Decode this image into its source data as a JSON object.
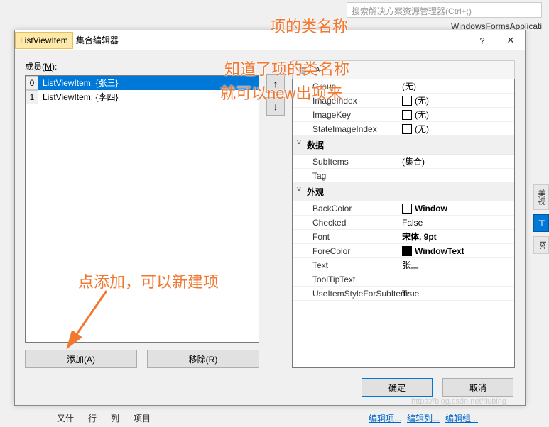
{
  "bg": {
    "search_placeholder": "搜索解决方案资源管理器(Ctrl+;)",
    "right_snippet": "WindowsFormsApplicati",
    "right_tabs": [
      "美视",
      "工",
      "ist"
    ],
    "bottom_items": [
      "又什",
      "行",
      "列",
      "项目"
    ],
    "bottom_links": [
      "编辑项...",
      "编辑列...",
      "编辑组..."
    ]
  },
  "dialog": {
    "title_highlight": "ListViewItem",
    "title_rest": " 集合编辑器",
    "help": "?",
    "close": "✕",
    "members_label_pre": "成员(",
    "members_label_u": "M",
    "members_label_post": "):",
    "members": [
      {
        "idx": "0",
        "text": "ListViewItem: {张三}",
        "selected": true
      },
      {
        "idx": "1",
        "text": "ListViewItem: {李四}",
        "selected": false
      }
    ],
    "add_btn": "添加(A)",
    "remove_btn": "移除(R)",
    "up": "↑",
    "down": "↓",
    "ok": "确定",
    "cancel": "取消"
  },
  "props": {
    "cats": [
      {
        "name": "行为_hidden",
        "rows": [
          {
            "name": "Group",
            "val": "(无)"
          },
          {
            "name": "ImageIndex",
            "val": "(无)",
            "swatch": "empty"
          },
          {
            "name": "ImageKey",
            "val": "(无)",
            "swatch": "empty"
          },
          {
            "name": "StateImageIndex",
            "val": "(无)",
            "swatch": "empty"
          }
        ]
      },
      {
        "name": "数据",
        "rows": [
          {
            "name": "SubItems",
            "val": "(集合)"
          },
          {
            "name": "Tag",
            "val": ""
          }
        ]
      },
      {
        "name": "外观",
        "rows": [
          {
            "name": "BackColor",
            "val": "Window",
            "swatch": "white",
            "bold": true
          },
          {
            "name": "Checked",
            "val": "False"
          },
          {
            "name": "Font",
            "val": "宋体, 9pt",
            "bold": true
          },
          {
            "name": "ForeColor",
            "val": "WindowText",
            "swatch": "black",
            "bold": true
          },
          {
            "name": "Text",
            "val": "张三"
          },
          {
            "name": "ToolTipText",
            "val": ""
          },
          {
            "name": "UseItemStyleForSubItems",
            "val": "True"
          }
        ]
      }
    ]
  },
  "annotations": {
    "a1": "项的类名称",
    "a2": "知道了项的类名称",
    "a3": "就可以new出项来",
    "a4": "点添加，可以新建项"
  },
  "watermark": "https://blog.csdn.net/ifubing"
}
